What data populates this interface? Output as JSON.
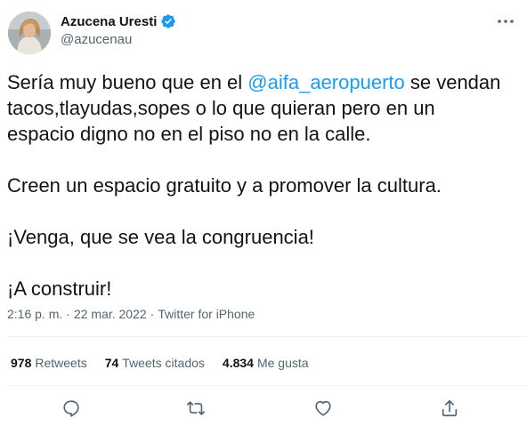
{
  "author": {
    "display_name": "Azucena Uresti",
    "handle": "@azucenau"
  },
  "tweet": {
    "line1_pre": "Sería muy bueno que en el ",
    "mention": "@aifa_aeropuerto",
    "line1_post": " se vendan",
    "line2": "tacos,tlayudas,sopes o lo que quieran pero en un",
    "line3": "espacio digno no en el piso no en la calle.",
    "line4": "Creen un espacio gratuito y a promover la cultura.",
    "line5": "¡Venga, que se vea la congruencia!",
    "line6": "¡A construir!"
  },
  "meta": {
    "time": "2:16 p. m.",
    "separator": "·",
    "date": "22 mar. 2022",
    "source": "Twitter for iPhone"
  },
  "stats": {
    "retweets_count": "978",
    "retweets_label": "Retweets",
    "quotes_count": "74",
    "quotes_label": "Tweets citados",
    "likes_count": "4.834",
    "likes_label": "Me gusta"
  },
  "icons": {
    "verified": "verified-badge-icon",
    "more": "more-options-icon",
    "reply": "reply-icon",
    "retweet": "retweet-icon",
    "like": "heart-icon",
    "share": "share-icon"
  },
  "colors": {
    "accent": "#1d9bf0",
    "secondary_text": "#536471",
    "primary_text": "#0f1419",
    "divider": "#eff3f4"
  }
}
